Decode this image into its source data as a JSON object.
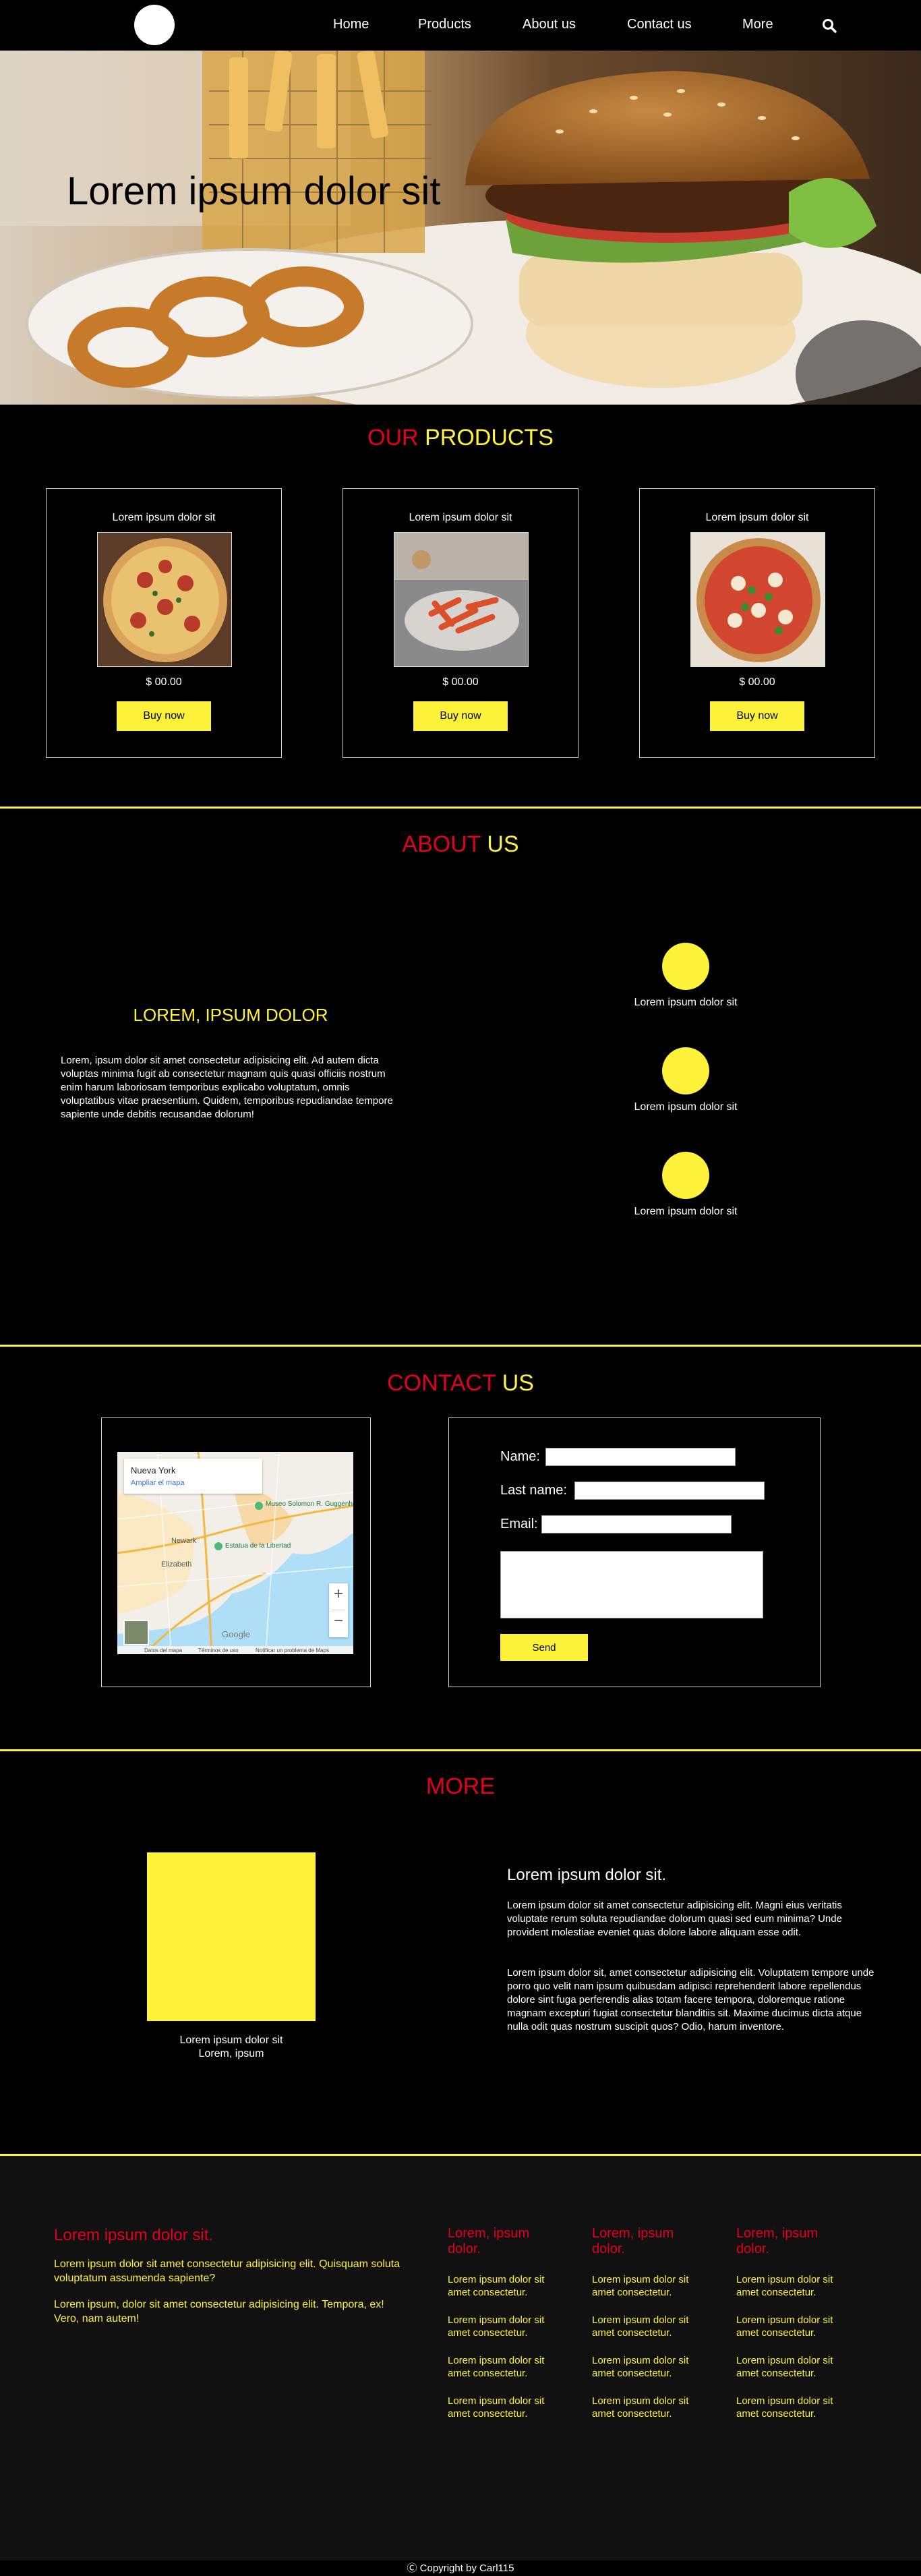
{
  "nav": {
    "links": [
      "Home",
      "Products",
      "About us",
      "Contact us",
      "More"
    ]
  },
  "hero": {
    "title": "Lorem ipsum dolor sit"
  },
  "products": {
    "title_part1": "OUR",
    "title_part2": "PRODUCTS",
    "items": [
      {
        "title": "Lorem ipsum dolor sit",
        "price": "$ 00.00",
        "button": "Buy now"
      },
      {
        "title": "Lorem ipsum dolor sit",
        "price": "$ 00.00",
        "button": "Buy now"
      },
      {
        "title": "Lorem ipsum dolor sit",
        "price": "$ 00.00",
        "button": "Buy now"
      }
    ]
  },
  "about": {
    "title_part1": "ABOUT",
    "title_part2": "US",
    "heading": "LOREM, IPSUM DOLOR",
    "text": "Lorem, ipsum dolor sit amet consectetur adipisicing elit. Ad autem dicta voluptas minima fugit ab consectetur magnam quis quasi officiis nostrum enim harum laboriosam temporibus explicabo voluptatum, omnis voluptatibus vitae praesentium. Quidem, temporibus repudiandae tempore sapiente unde debitis recusandae dolorum!",
    "features": [
      "Lorem ipsum dolor sit",
      "Lorem ipsum dolor sit",
      "Lorem ipsum dolor sit"
    ]
  },
  "contact": {
    "title_part1": "CONTACT",
    "title_part2": "US",
    "map": {
      "place": "Nueva York",
      "link": "Ampliar el mapa",
      "footer_items": [
        "Datos del mapa",
        "Términos de uso",
        "Notificar un problema de Maps"
      ],
      "labels": [
        "Newark",
        "Elizabeth",
        "Museo Solomon R. Guggenheim",
        "Estatua de la Libertad"
      ],
      "brand": "Google"
    },
    "form": {
      "name_label": "Name:",
      "lastname_label": "Last name:",
      "email_label": "Email:",
      "send": "Send"
    }
  },
  "more": {
    "title": "MORE",
    "caption_line1": "Lorem ipsum dolor sit",
    "caption_line2": "Lorem, ipsum",
    "heading": "Lorem ipsum dolor sit.",
    "para1": "Lorem ipsum dolor sit amet consectetur adipisicing elit. Magni eius veritatis voluptate rerum soluta repudiandae dolorum quasi sed eum minima? Unde provident molestiae eveniet quas dolore labore aliquam esse odit.",
    "para2": "Lorem ipsum dolor sit, amet consectetur adipisicing elit. Voluptatem tempore unde porro quo velit nam ipsum quibusdam adipisci reprehenderit labore repellendus dolore sint fuga perferendis alias totam facere tempora, doloremque ratione magnam excepturi fugiat consectetur blanditiis sit. Maxime ducimus dicta atque nulla odit quas nostrum suscipit quos? Odio, harum inventore."
  },
  "footer": {
    "heading": "Lorem ipsum dolor sit.",
    "text1": "Lorem ipsum dolor sit amet consectetur adipisicing elit. Quisquam soluta voluptatum assumenda sapiente?",
    "text2": "Lorem ipsum, dolor sit amet consectetur adipisicing elit. Tempora, ex! Vero, nam autem!",
    "columns": [
      {
        "title": "Lorem, ipsum dolor.",
        "links": [
          "Lorem ipsum dolor sit amet consectetur.",
          "Lorem ipsum dolor sit amet consectetur.",
          "Lorem ipsum dolor sit amet consectetur.",
          "Lorem ipsum dolor sit amet consectetur."
        ]
      },
      {
        "title": "Lorem, ipsum dolor.",
        "links": [
          "Lorem ipsum dolor sit amet consectetur.",
          "Lorem ipsum dolor sit amet consectetur.",
          "Lorem ipsum dolor sit amet consectetur.",
          "Lorem ipsum dolor sit amet consectetur."
        ]
      },
      {
        "title": "Lorem, ipsum dolor.",
        "links": [
          "Lorem ipsum dolor sit amet consectetur.",
          "Lorem ipsum dolor sit amet consectetur.",
          "Lorem ipsum dolor sit amet consectetur.",
          "Lorem ipsum dolor sit amet consectetur."
        ]
      }
    ],
    "copyright": "Ⓒ Copyright by Carl115"
  },
  "colors": {
    "accent_yellow": "#fff23a",
    "accent_red": "#e3001b",
    "background": "#000000",
    "footer_background": "#111111"
  },
  "icons": [
    "search-icon",
    "logo"
  ]
}
